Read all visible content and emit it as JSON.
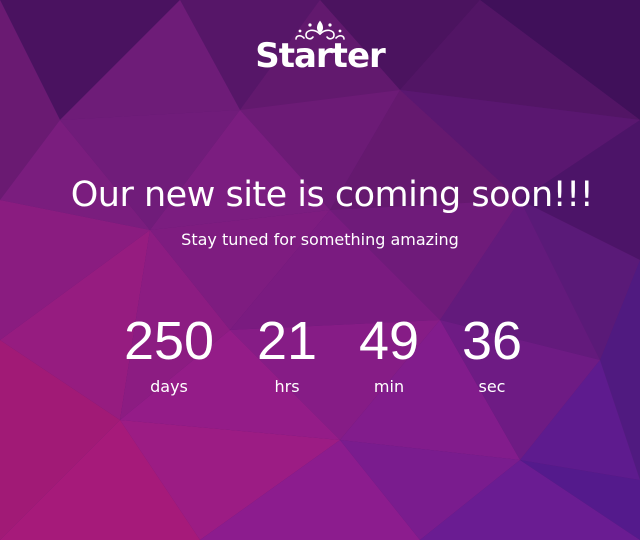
{
  "logo": {
    "text": "Starter",
    "icon": "ornament-icon"
  },
  "hero": {
    "headline": "Our new site is coming soon!!!",
    "subline": "Stay tuned for something amazing"
  },
  "countdown": {
    "units": [
      {
        "value": "250",
        "label": "days"
      },
      {
        "value": "21",
        "label": "hrs"
      },
      {
        "value": "49",
        "label": "min"
      },
      {
        "value": "36",
        "label": "sec"
      }
    ]
  },
  "colors": {
    "background_primary": "#5a1a6e",
    "background_accent": "#8e1a8c",
    "background_dark": "#3d0f4f",
    "text": "#ffffff"
  }
}
